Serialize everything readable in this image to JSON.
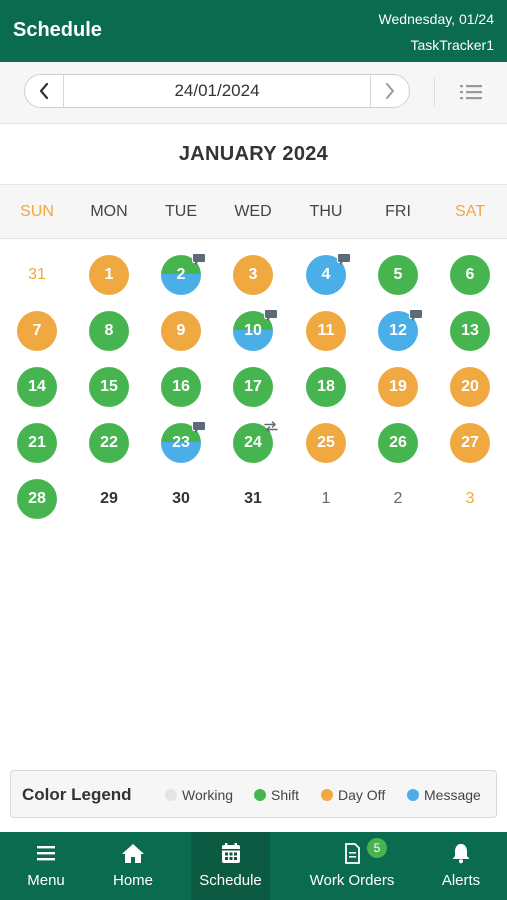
{
  "header": {
    "title": "Schedule",
    "date": "Wednesday, 01/24",
    "user": "TaskTracker1"
  },
  "date_picker": {
    "value": "24/01/2024",
    "prev_icon": "chevron-left-icon",
    "next_icon": "chevron-right-icon",
    "list_icon": "list-view-icon"
  },
  "calendar": {
    "month_title": "JANUARY 2024",
    "weekdays": [
      "SUN",
      "MON",
      "TUE",
      "WED",
      "THU",
      "FRI",
      "SAT"
    ],
    "weeks": [
      [
        {
          "day": "31",
          "status": "outside-weekend"
        },
        {
          "day": "1",
          "status": "day-off"
        },
        {
          "day": "2",
          "status": "shift-message",
          "marker": "message"
        },
        {
          "day": "3",
          "status": "day-off"
        },
        {
          "day": "4",
          "status": "message",
          "marker": "message"
        },
        {
          "day": "5",
          "status": "shift"
        },
        {
          "day": "6",
          "status": "shift"
        }
      ],
      [
        {
          "day": "7",
          "status": "day-off"
        },
        {
          "day": "8",
          "status": "shift"
        },
        {
          "day": "9",
          "status": "day-off"
        },
        {
          "day": "10",
          "status": "shift-message",
          "marker": "message"
        },
        {
          "day": "11",
          "status": "day-off"
        },
        {
          "day": "12",
          "status": "message",
          "marker": "message"
        },
        {
          "day": "13",
          "status": "shift"
        }
      ],
      [
        {
          "day": "14",
          "status": "shift"
        },
        {
          "day": "15",
          "status": "shift"
        },
        {
          "day": "16",
          "status": "shift"
        },
        {
          "day": "17",
          "status": "shift"
        },
        {
          "day": "18",
          "status": "shift"
        },
        {
          "day": "19",
          "status": "day-off"
        },
        {
          "day": "20",
          "status": "day-off"
        }
      ],
      [
        {
          "day": "21",
          "status": "shift"
        },
        {
          "day": "22",
          "status": "shift"
        },
        {
          "day": "23",
          "status": "shift-message",
          "marker": "message"
        },
        {
          "day": "24",
          "status": "shift",
          "marker": "swap"
        },
        {
          "day": "25",
          "status": "day-off"
        },
        {
          "day": "26",
          "status": "shift"
        },
        {
          "day": "27",
          "status": "day-off"
        }
      ],
      [
        {
          "day": "28",
          "status": "shift"
        },
        {
          "day": "29",
          "status": "none"
        },
        {
          "day": "30",
          "status": "none"
        },
        {
          "day": "31",
          "status": "none"
        },
        {
          "day": "1",
          "status": "outside"
        },
        {
          "day": "2",
          "status": "outside"
        },
        {
          "day": "3",
          "status": "outside-weekend"
        }
      ]
    ]
  },
  "legend": {
    "label": "Color Legend",
    "items": [
      {
        "label": "Working",
        "color": "#e4e4e4"
      },
      {
        "label": "Shift",
        "color": "#46b550"
      },
      {
        "label": "Day Off",
        "color": "#f0a841"
      },
      {
        "label": "Message",
        "color": "#4aaee9"
      }
    ]
  },
  "tabs": [
    {
      "label": "Menu",
      "icon": "hamburger-icon",
      "active": false
    },
    {
      "label": "Home",
      "icon": "home-icon",
      "active": false
    },
    {
      "label": "Schedule",
      "icon": "calendar-icon",
      "active": true
    },
    {
      "label": "Work Orders",
      "icon": "document-icon",
      "active": false,
      "badge": "5"
    },
    {
      "label": "Alerts",
      "icon": "bell-icon",
      "active": false
    }
  ],
  "colors": {
    "brand": "#0b6b4f",
    "shift": "#46b550",
    "day_off": "#f0a841",
    "message": "#4aaee9"
  }
}
